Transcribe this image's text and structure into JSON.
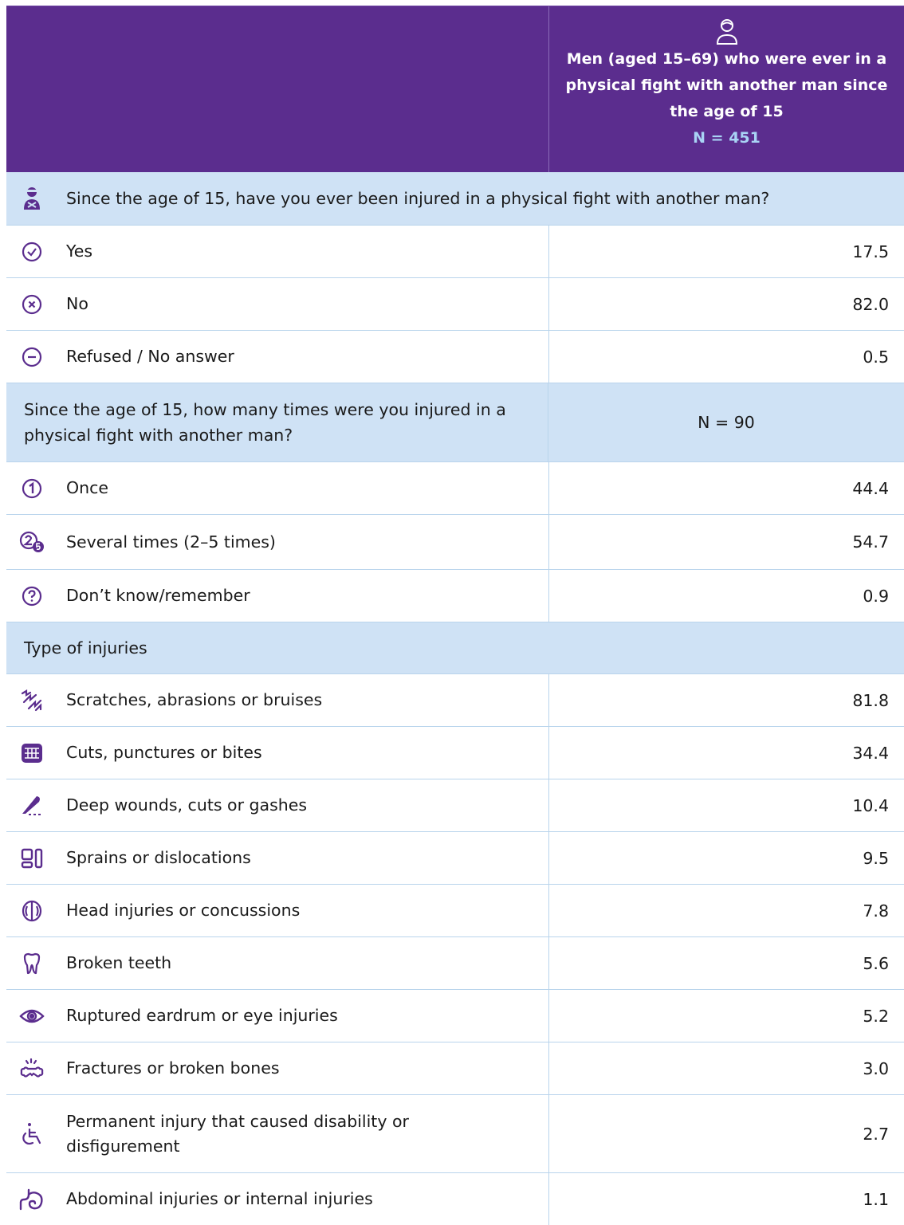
{
  "header": {
    "title": "Men (aged 15–69) who were ever in a physical fight with another man since the age of 15",
    "n": "N = 451"
  },
  "section1": {
    "question": "Since the age of 15, have you ever been injured in a physical fight with another man?",
    "rows": [
      {
        "icon": "check-circle-icon",
        "label": "Yes",
        "value": "17.5"
      },
      {
        "icon": "x-circle-icon",
        "label": "No",
        "value": "82.0"
      },
      {
        "icon": "minus-circle-icon",
        "label": "Refused / No answer",
        "value": "0.5"
      }
    ]
  },
  "section2": {
    "question": "Since the age of 15, how many times were you injured in a physical fight with another man?",
    "n": "N = 90",
    "rows": [
      {
        "icon": "number-one-icon",
        "label": "Once",
        "value": "44.4"
      },
      {
        "icon": "number-two-five-icon",
        "label": "Several times (2–5 times)",
        "value": "54.7"
      },
      {
        "icon": "question-circle-icon",
        "label": "Don’t know/remember",
        "value": "0.9"
      }
    ]
  },
  "section3": {
    "title": "Type of injuries",
    "rows": [
      {
        "icon": "scratches-icon",
        "label": "Scratches, abrasions or bruises",
        "value": "81.8"
      },
      {
        "icon": "bite-icon",
        "label": "Cuts, punctures or bites",
        "value": "34.4"
      },
      {
        "icon": "scalpel-icon",
        "label": "Deep wounds, cuts or gashes",
        "value": "10.4"
      },
      {
        "icon": "dislocation-icon",
        "label": "Sprains or dislocations",
        "value": "9.5"
      },
      {
        "icon": "brain-icon",
        "label": "Head injuries or concussions",
        "value": "7.8"
      },
      {
        "icon": "tooth-icon",
        "label": "Broken teeth",
        "value": "5.6"
      },
      {
        "icon": "eye-icon",
        "label": "Ruptured eardrum or eye injuries",
        "value": "5.2"
      },
      {
        "icon": "broken-bone-icon",
        "label": "Fractures or broken bones",
        "value": "3.0"
      },
      {
        "icon": "wheelchair-icon",
        "label": "Permanent injury that caused disability or disfigurement",
        "value": "2.7"
      },
      {
        "icon": "stomach-icon",
        "label": "Abdominal injuries or internal injuries",
        "value": "1.1"
      }
    ]
  },
  "colors": {
    "header_bg": "#5b2d8e",
    "section_bg": "#cfe2f5",
    "icon": "#5b2d8e",
    "n_highlight": "#a9d3f5"
  }
}
